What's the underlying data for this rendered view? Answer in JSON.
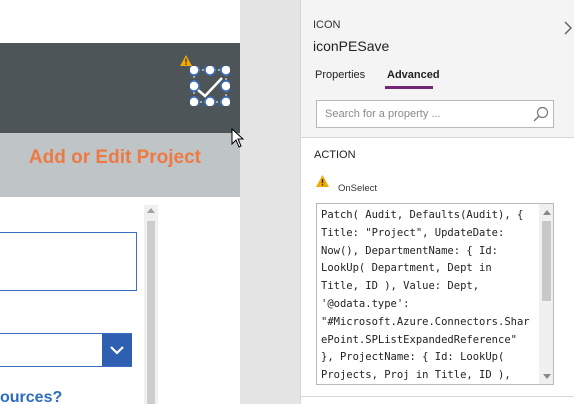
{
  "canvas": {
    "page_title": "Add or Edit Project",
    "link_text": "ources?"
  },
  "panel": {
    "control_type": "ICON",
    "control_name": "iconPESave",
    "collapse_icon": "chevron-right-icon",
    "tabs": [
      {
        "label": "Properties",
        "active": false
      },
      {
        "label": "Advanced",
        "active": true
      }
    ],
    "search": {
      "placeholder": "Search for a property ..."
    },
    "section_title": "ACTION",
    "property_name": "OnSelect",
    "formula_lines": [
      "Patch( Audit, Defaults(Audit), {",
      "Title: \"Project\", UpdateDate:",
      "Now(), DepartmentName: { Id:",
      "LookUp( Department, Dept in",
      "Title, ID ), Value: Dept,",
      "'@odata.type':",
      "\"#Microsoft.Azure.Connectors.Shar",
      "ePoint.SPListExpandedReference\"",
      "}, ProjectName: { Id: LookUp(",
      "Projects, Proj in Title, ID ),"
    ]
  },
  "colors": {
    "header": "#4d5558",
    "title_accent": "#ee7a43",
    "active_tab": "#742774",
    "input_border": "#3a6fc4",
    "warning": "#f2a900"
  }
}
